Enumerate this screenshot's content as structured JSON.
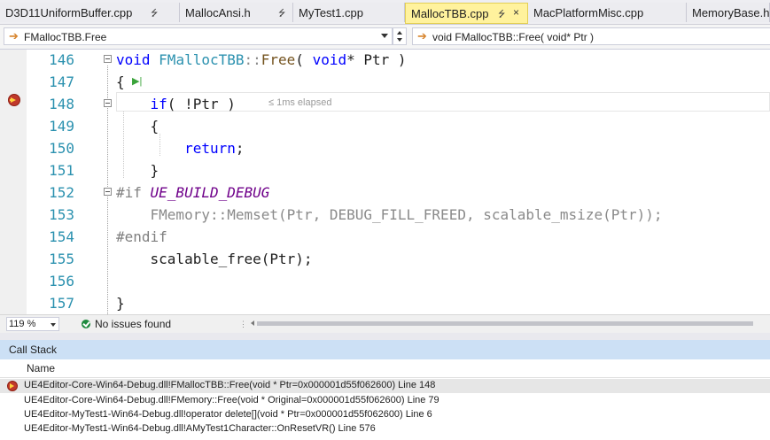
{
  "tabs": [
    {
      "label": "D3D11UniformBuffer.cpp",
      "pin": "⭍"
    },
    {
      "label": "MallocAnsi.h",
      "pin": "⭍"
    },
    {
      "label": "MyTest1.cpp",
      "pin": ""
    },
    {
      "label": "MallocTBB.cpp",
      "pin": "⭍",
      "close": "×",
      "active": true
    },
    {
      "label": "MacPlatformMisc.cpp",
      "pin": ""
    },
    {
      "label": "MemoryBase.h",
      "pin": ""
    }
  ],
  "navbar": {
    "scope": "FMallocTBB.Free",
    "member": "void FMallocTBB::Free( void* Ptr )"
  },
  "editor": {
    "lines": [
      {
        "num": "146",
        "tokens": [
          {
            "t": "void",
            "c": "kw"
          },
          {
            "t": " "
          },
          {
            "t": "FMallocTBB",
            "c": "cls"
          },
          {
            "t": "::",
            "c": "grey"
          },
          {
            "t": "Free",
            "c": "fn"
          },
          {
            "t": "( "
          },
          {
            "t": "void",
            "c": "kw"
          },
          {
            "t": "* Ptr )"
          }
        ],
        "fold": true
      },
      {
        "num": "147",
        "tokens": [
          {
            "t": "{"
          }
        ]
      },
      {
        "num": "148",
        "tokens": [
          {
            "t": "    "
          },
          {
            "t": "if",
            "c": "kw"
          },
          {
            "t": "( !Ptr )"
          }
        ],
        "fold": true
      },
      {
        "num": "149",
        "tokens": [
          {
            "t": "    {"
          }
        ]
      },
      {
        "num": "150",
        "tokens": [
          {
            "t": "        "
          },
          {
            "t": "return",
            "c": "kw"
          },
          {
            "t": ";"
          }
        ]
      },
      {
        "num": "151",
        "tokens": [
          {
            "t": "    }"
          }
        ]
      },
      {
        "num": "152",
        "tokens": [
          {
            "t": "#if ",
            "c": "pre"
          },
          {
            "t": "UE_BUILD_DEBUG",
            "c": "macro-i"
          }
        ],
        "fold": true
      },
      {
        "num": "153",
        "tokens": [
          {
            "t": "    FMemory",
            "c": "grey"
          },
          {
            "t": "::",
            "c": "grey"
          },
          {
            "t": "Memset(Ptr, DEBUG_FILL_FREED, scalable_msize(Ptr));",
            "c": "grey"
          }
        ]
      },
      {
        "num": "154",
        "tokens": [
          {
            "t": "#endif",
            "c": "pre"
          }
        ]
      },
      {
        "num": "155",
        "tokens": [
          {
            "t": "    scalable_free(Ptr);"
          }
        ]
      },
      {
        "num": "156",
        "tokens": [
          {
            "t": ""
          }
        ]
      },
      {
        "num": "157",
        "tokens": [
          {
            "t": "}"
          }
        ]
      }
    ],
    "perf_tip": "≤ 1ms elapsed",
    "run_to_click": "▶|"
  },
  "status": {
    "zoom": "119 %",
    "issues": "No issues found"
  },
  "callstack": {
    "title": "Call Stack",
    "column_name": "Name",
    "rows": [
      {
        "text": "UE4Editor-Core-Win64-Debug.dll!FMallocTBB::Free(void * Ptr=0x000001d55f062600) Line 148",
        "current": true
      },
      {
        "text": "UE4Editor-Core-Win64-Debug.dll!FMemory::Free(void * Original=0x000001d55f062600) Line 79",
        "current": false
      },
      {
        "text": "UE4Editor-MyTest1-Win64-Debug.dll!operator delete[](void * Ptr=0x000001d55f062600) Line 6",
        "current": false
      },
      {
        "text": "UE4Editor-MyTest1-Win64-Debug.dll!AMyTest1Character::OnResetVR() Line 576",
        "current": false
      }
    ]
  }
}
